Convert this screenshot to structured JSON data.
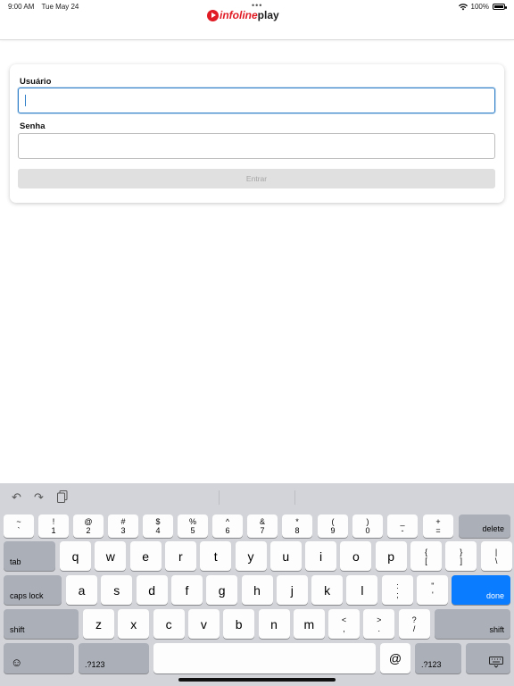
{
  "status": {
    "time": "9:00 AM",
    "date": "Tue May 24",
    "battery": "100%"
  },
  "header": {
    "logo_part1": "infoline",
    "logo_part2": "play"
  },
  "form": {
    "user_label": "Usuário",
    "user_value": "",
    "pass_label": "Senha",
    "pass_value": "",
    "submit_label": "Entrar"
  },
  "keyboard": {
    "number_row": [
      {
        "top": "~",
        "bottom": "`"
      },
      {
        "top": "!",
        "bottom": "1"
      },
      {
        "top": "@",
        "bottom": "2"
      },
      {
        "top": "#",
        "bottom": "3"
      },
      {
        "top": "$",
        "bottom": "4"
      },
      {
        "top": "%",
        "bottom": "5"
      },
      {
        "top": "^",
        "bottom": "6"
      },
      {
        "top": "&",
        "bottom": "7"
      },
      {
        "top": "*",
        "bottom": "8"
      },
      {
        "top": "(",
        "bottom": "9"
      },
      {
        "top": ")",
        "bottom": "0"
      },
      {
        "top": "_",
        "bottom": "-"
      },
      {
        "top": "+",
        "bottom": "="
      }
    ],
    "delete": "delete",
    "tab": "tab",
    "row_q": [
      "q",
      "w",
      "e",
      "r",
      "t",
      "y",
      "u",
      "i",
      "o",
      "p"
    ],
    "row_q_symbols": [
      {
        "top": "{",
        "bottom": "["
      },
      {
        "top": "}",
        "bottom": "]"
      },
      {
        "top": "|",
        "bottom": "\\"
      }
    ],
    "caps_lock": "caps lock",
    "row_a": [
      "a",
      "s",
      "d",
      "f",
      "g",
      "h",
      "j",
      "k",
      "l"
    ],
    "row_a_symbols": [
      {
        "top": ":",
        "bottom": ";"
      },
      {
        "top": "\"",
        "bottom": "'"
      }
    ],
    "done": "done",
    "shift": "shift",
    "row_z": [
      "z",
      "x",
      "c",
      "v",
      "b",
      "n",
      "m"
    ],
    "row_z_symbols": [
      {
        "top": "<",
        "bottom": ","
      },
      {
        "top": ">",
        "bottom": "."
      },
      {
        "top": "?",
        "bottom": "/"
      }
    ],
    "numbers_toggle": ".?123",
    "at": "@",
    "emoji_icon": "emoji-icon",
    "dismiss_icon": "keyboard-dismiss-icon"
  }
}
